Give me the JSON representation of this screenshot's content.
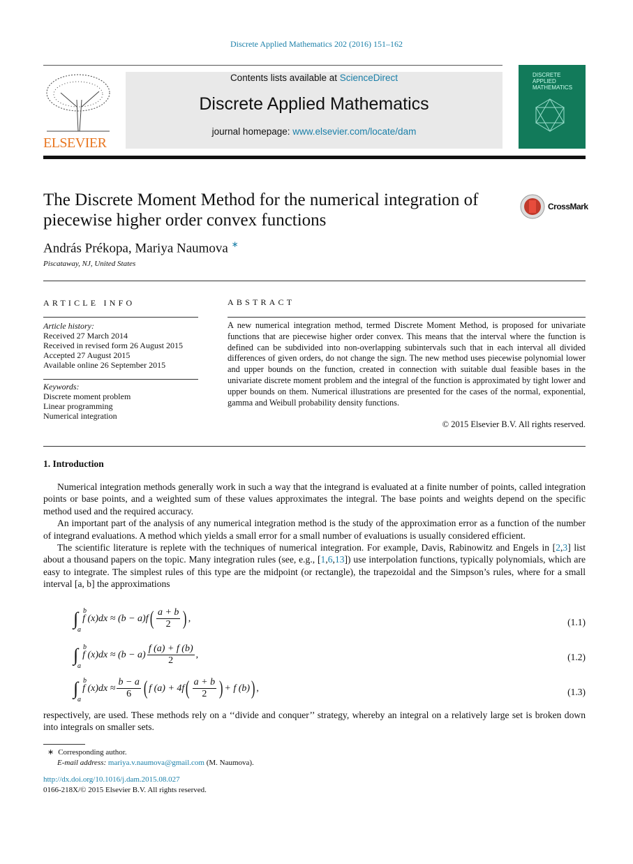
{
  "header": {
    "citation": "Discrete Applied Mathematics 202 (2016) 151–162",
    "contents_prefix": "Contents lists available at ",
    "sciencedirect": "ScienceDirect",
    "journal": "Discrete Applied Mathematics",
    "homepage_prefix": "journal homepage: ",
    "homepage_url": "www.elsevier.com/locate/dam",
    "publisher": "ELSEVIER",
    "cover_title": "DISCRETE\nAPPLIED\nMATHEMATICS"
  },
  "article": {
    "title": "The Discrete Moment Method for the numerical integration of piecewise higher order convex functions",
    "crossmark": "CrossMark",
    "authors": "András Prékopa, Mariya Naumova",
    "author_mark": "∗",
    "affiliation": "Piscataway, NJ, United States"
  },
  "info": {
    "heading": "ARTICLE INFO",
    "history_label": "Article history:",
    "history": [
      "Received 27 March 2014",
      "Received in revised form 26 August 2015",
      "Accepted 27 August 2015",
      "Available online 26 September 2015"
    ],
    "keywords_label": "Keywords:",
    "keywords": [
      "Discrete moment problem",
      "Linear programming",
      "Numerical integration"
    ]
  },
  "abstract": {
    "heading": "ABSTRACT",
    "text": "A new numerical integration method, termed Discrete Moment Method, is proposed for univariate functions that are piecewise higher order convex. This means that the interval where the function is defined can be subdivided into non-overlapping subintervals such that in each interval all divided differences of given orders, do not change the sign. The new method uses piecewise polynomial lower and upper bounds on the function, created in connection with suitable dual feasible bases in the univariate discrete moment problem and the integral of the function is approximated by tight lower and upper bounds on them. Numerical illustrations are presented for the cases of the normal, exponential, gamma and Weibull probability density functions.",
    "copyright": "© 2015 Elsevier B.V. All rights reserved."
  },
  "intro": {
    "heading": "1.  Introduction",
    "p1": "Numerical integration methods generally work in such a way that the integrand is evaluated at a finite number of points, called integration points or base points, and a weighted sum of these values approximates the integral. The base points and weights depend on the specific method used and the required accuracy.",
    "p2": "An important part of the analysis of any numerical integration method is the study of the approximation error as a function of the number of integrand evaluations. A method which yields a small error for a small number of evaluations is usually considered efficient.",
    "p3a": "The scientific literature is replete with the techniques of numerical integration. For example, Davis, Rabinowitz and Engels in [",
    "r2": "2",
    "comma": ",",
    "r3": "3",
    "p3b": "] list about a thousand papers on the topic. Many integration rules (see, e.g., [",
    "r1": "1",
    "r6": "6",
    "r13": "13",
    "p3c": "]) use interpolation functions, typically polynomials, which are easy to integrate. The simplest rules of this type are the midpoint (or rectangle), the trapezoidal and the Simpson’s rules, where for a small interval [a, b] the approximations",
    "p4": "respectively, are used. These methods rely on a ‘‘divide and conquer’’ strategy, whereby an integral on a relatively large set is broken down into integrals on smaller sets."
  },
  "equations": [
    {
      "lhs": "f (x)dx ≈ (b − a)f",
      "num": "a + b",
      "den": "2",
      "tail": ",",
      "number": "(1.1)"
    },
    {
      "lhs": "f (x)dx ≈ (b − a)",
      "num": "f (a) + f (b)",
      "den": "2",
      "tail": ",",
      "number": "(1.2)"
    },
    {
      "lhs": "f (x)dx ≈",
      "num": "b − a",
      "den": "6",
      "mid": "f (a) + 4f",
      "num2": "a + b",
      "den2": "2",
      "tail": "+ f (b)",
      "end": ",",
      "number": "(1.3)"
    }
  ],
  "integral": {
    "symbol": "∫",
    "upper": "b",
    "lower": "a"
  },
  "footnote": {
    "mark": "∗",
    "label": "Corresponding author.",
    "email_label": "E-mail address: ",
    "email": "mariya.v.naumova@gmail.com",
    "email_suffix": " (M. Naumova).",
    "doi": "http://dx.doi.org/10.1016/j.dam.2015.08.027",
    "issn": "0166-218X/© 2015 Elsevier B.V. All rights reserved."
  }
}
